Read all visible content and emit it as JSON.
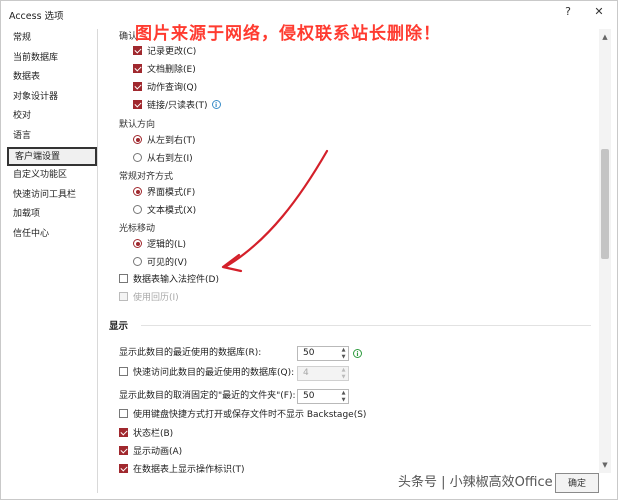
{
  "window": {
    "title": "Access 选项",
    "help": "?",
    "close": "✕"
  },
  "watermark_top": "图片来源于网络，侵权联系站长删除！",
  "sidebar": {
    "items": [
      {
        "label": "常规"
      },
      {
        "label": "当前数据库"
      },
      {
        "label": "数据表"
      },
      {
        "label": "对象设计器"
      },
      {
        "label": "校对"
      },
      {
        "label": "语言"
      },
      {
        "label": "客户端设置",
        "selected": true
      },
      {
        "label": "自定义功能区"
      },
      {
        "label": "快速访问工具栏"
      },
      {
        "label": "加载项"
      },
      {
        "label": "信任中心"
      }
    ]
  },
  "confirm": {
    "label": "确认",
    "items": [
      {
        "label": "记录更改(C)",
        "checked": true
      },
      {
        "label": "文档删除(E)",
        "checked": true
      },
      {
        "label": "动作查询(Q)",
        "checked": true
      },
      {
        "label": "链接/只读表(T)",
        "checked": true
      }
    ]
  },
  "default_direction": {
    "label": "默认方向",
    "options": [
      {
        "label": "从左到右(T)",
        "checked": true
      },
      {
        "label": "从右到左(I)",
        "checked": false
      }
    ]
  },
  "general_alignment": {
    "label": "常规对齐方式",
    "options": [
      {
        "label": "界面模式(F)",
        "checked": true
      },
      {
        "label": "文本模式(X)",
        "checked": false
      }
    ]
  },
  "cursor_movement": {
    "label": "光标移动",
    "options": [
      {
        "label": "逻辑的(L)",
        "checked": true
      },
      {
        "label": "可见的(V)",
        "checked": false
      }
    ]
  },
  "ime_control": {
    "label": "数据表输入法控件(D)",
    "checked": false
  },
  "hijri": {
    "label": "使用回历(I)",
    "checked": false
  },
  "display": {
    "title": "显示",
    "recent_db_label": "显示此数目的最近使用的数据库(R):",
    "recent_db_value": "50",
    "quick_access_label": "快速访问此数目的最近使用的数据库(Q):",
    "quick_access_value": "4",
    "unpinned_label": "显示此数目的取消固定的\"最近的文件夹\"(F):",
    "unpinned_value": "50",
    "backstage_label": "使用键盘快捷方式打开或保存文件时不显示 Backstage(S)",
    "statusbar_label": "状态栏(B)",
    "animation_label": "显示动画(A)",
    "datasheet_label": "在数据表上显示操作标识(T)"
  },
  "footer": {
    "watermark": "头条号 | 小辣椒高效Office",
    "ok_label": "确定"
  },
  "colors": {
    "accent": "#a0282e",
    "arrow": "#d4202a",
    "watermark": "#ff3b30"
  }
}
